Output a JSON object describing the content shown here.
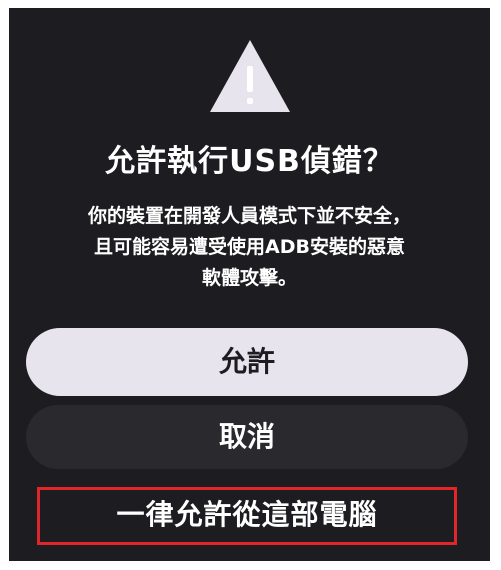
{
  "dialog": {
    "icon": "warning-triangle-icon",
    "title": "允許執行USB偵錯？",
    "message_lines": [
      "你的裝置在開發人員模式下並不安全，",
      "且可能容易遭受使用ADB安裝的惡意",
      "軟體攻擊。"
    ],
    "buttons": {
      "allow": "允許",
      "cancel": "取消",
      "always_allow": "一律允許從這部電腦"
    }
  },
  "colors": {
    "background": "#1d1c20",
    "allow_button": "#e8e4ed",
    "cancel_button": "#2a292d",
    "highlight_border": "#e0262b",
    "warning_icon": "#e8e4ed"
  }
}
